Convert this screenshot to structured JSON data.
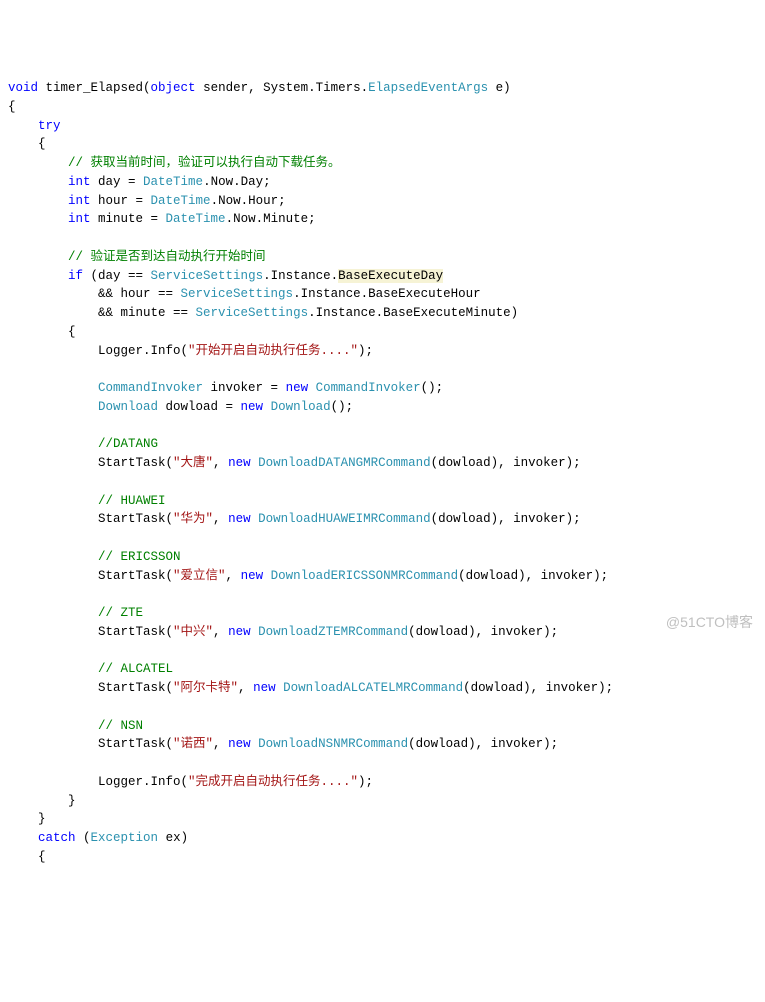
{
  "code": {
    "sig_void": "void",
    "sig_name": " timer_Elapsed(",
    "sig_obj": "object",
    "sig_sender": " sender, System.Timers.",
    "sig_args_t": "ElapsedEventArgs",
    "sig_args_n": " e)",
    "brace_open": "{",
    "try_kw": "try",
    "brace_open2": "{",
    "c_getnow": "// 获取当前时间，验证可以执行自动下载任务。",
    "int1": "int",
    "day_decl": " day = ",
    "datetime": "DateTime",
    "now_day": ".Now.Day;",
    "int2": "int",
    "hour_decl": " hour = ",
    "now_hour": ".Now.Hour;",
    "int3": "int",
    "min_decl": " minute = ",
    "now_min": ".Now.Minute;",
    "c_verify": "// 验证是否到达自动执行开始时间",
    "if_kw": "if",
    "if_open": " (day == ",
    "svc": "ServiceSettings",
    "inst": ".Instance.",
    "base_day": "BaseExecuteDay",
    "and1": "&& hour == ",
    "base_hour": ".Instance.BaseExecuteHour",
    "and2": "&& minute == ",
    "base_min": ".Instance.BaseExecuteMinute)",
    "brace_open3": "{",
    "log_open": "Logger.Info(",
    "log_s1": "\"开始开启自动执行任务....\"",
    "log_close": ");",
    "cmdinv_t": "CommandInvoker",
    "invoker_decl": " invoker = ",
    "new_kw": "new",
    "cmdinv_ctor": "CommandInvoker",
    "ctor_end": "();",
    "download_t": "Download",
    "download_decl": " dowload = ",
    "download_ctor": "Download",
    "c_datang": "//DATANG",
    "st_open": "StartTask(",
    "s_datang": "\"大唐\"",
    "comma_new": ", ",
    "t_datang": "DownloadDATANGMRCommand",
    "args_tail": "(dowload), invoker);",
    "c_huawei": "// HUAWEI",
    "s_huawei": "\"华为\"",
    "t_huawei": "DownloadHUAWEIMRCommand",
    "c_ericsson": "// ERICSSON",
    "s_ericsson": "\"爱立信\"",
    "t_ericsson": "DownloadERICSSONMRCommand",
    "c_zte": "// ZTE",
    "s_zte": "\"中兴\"",
    "t_zte": "DownloadZTEMRCommand",
    "c_alcatel": "// ALCATEL",
    "s_alcatel": "\"阿尔卡特\"",
    "t_alcatel": "DownloadALCATELMRCommand",
    "c_nsn": "// NSN",
    "s_nsn": "\"诺西\"",
    "t_nsn": "DownloadNSNMRCommand",
    "log_s2": "\"完成开启自动执行任务....\"",
    "brace_close3": "}",
    "brace_close2": "}",
    "catch_kw": "catch",
    "catch_open": " (",
    "exception_t": "Exception",
    "catch_var": " ex)",
    "brace_open4": "{"
  },
  "watermark": "@51CTO博客"
}
